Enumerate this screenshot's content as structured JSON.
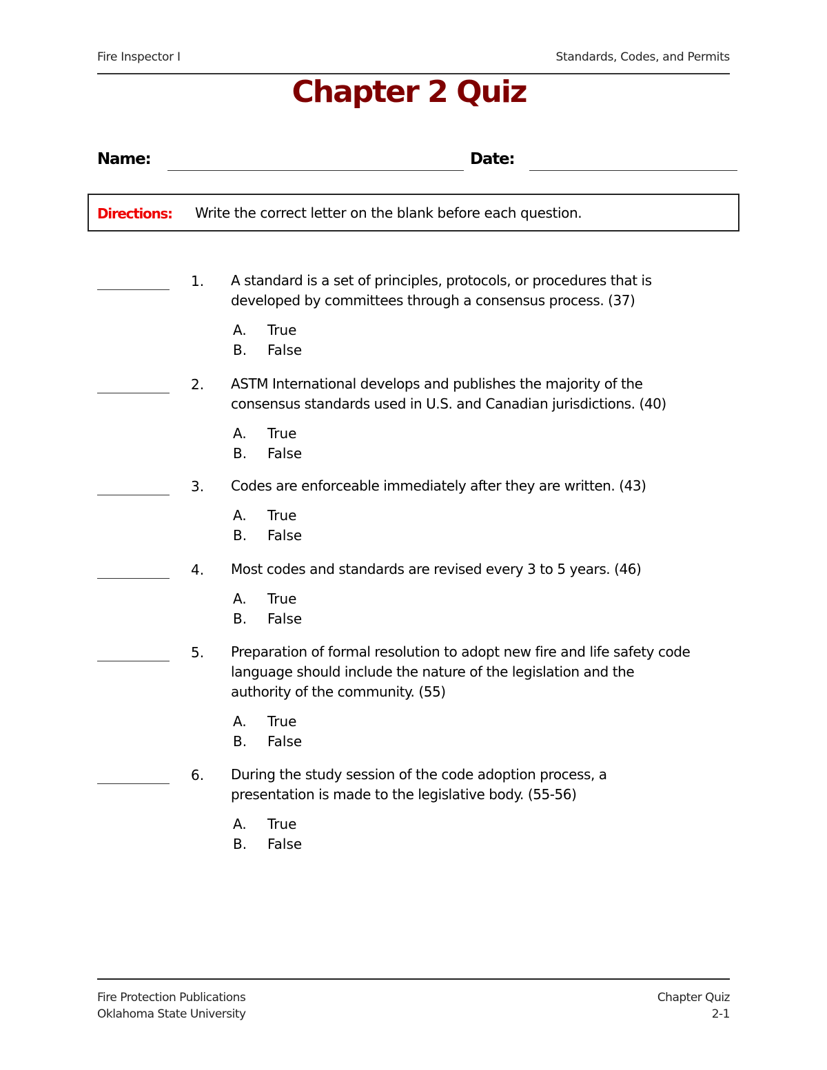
{
  "header": {
    "left": "Fire Inspector I",
    "right": "Standards, Codes, and Permits"
  },
  "title": "Chapter 2 Quiz",
  "title_color": "#7f0000",
  "form": {
    "name_label": "Name:",
    "date_label": "Date:"
  },
  "directions": {
    "label": "Directions:",
    "label_color": "#ee0000",
    "text": "Write the correct letter on the blank before each question."
  },
  "questions": [
    {
      "number": "1.",
      "lines": [
        "A standard is a set of principles, protocols, or procedures that is",
        "developed by committees through a consensus process. (37)"
      ],
      "options": [
        {
          "letter": "A.",
          "text": "True"
        },
        {
          "letter": "B.",
          "text": "False"
        }
      ]
    },
    {
      "number": "2.",
      "lines": [
        "ASTM International develops and publishes the majority of the",
        "consensus standards used in U.S. and Canadian jurisdictions. (40)"
      ],
      "options": [
        {
          "letter": "A.",
          "text": "True"
        },
        {
          "letter": "B.",
          "text": "False"
        }
      ]
    },
    {
      "number": "3.",
      "lines": [
        "Codes are enforceable immediately after they are written. (43)"
      ],
      "options": [
        {
          "letter": "A.",
          "text": "True"
        },
        {
          "letter": "B.",
          "text": "False"
        }
      ]
    },
    {
      "number": "4.",
      "lines": [
        "Most codes and standards are revised every 3 to 5 years. (46)"
      ],
      "options": [
        {
          "letter": "A.",
          "text": "True"
        },
        {
          "letter": "B.",
          "text": "False"
        }
      ]
    },
    {
      "number": "5.",
      "lines": [
        "Preparation of formal resolution to adopt new fire and life safety code",
        "language should include the nature of the legislation and the",
        "authority of the community. (55)"
      ],
      "options": [
        {
          "letter": "A.",
          "text": "True"
        },
        {
          "letter": "B.",
          "text": "False"
        }
      ]
    },
    {
      "number": "6.",
      "lines": [
        "During the study session of the code adoption process, a",
        "presentation is made to the legislative body. (55-56)"
      ],
      "options": [
        {
          "letter": "A.",
          "text": "True"
        },
        {
          "letter": "B.",
          "text": "False"
        }
      ]
    }
  ],
  "footer": {
    "left_line1": "Fire Protection Publications",
    "left_line2": "Oklahoma State University",
    "right_line1": "Chapter Quiz",
    "right_line2": "2-1"
  }
}
